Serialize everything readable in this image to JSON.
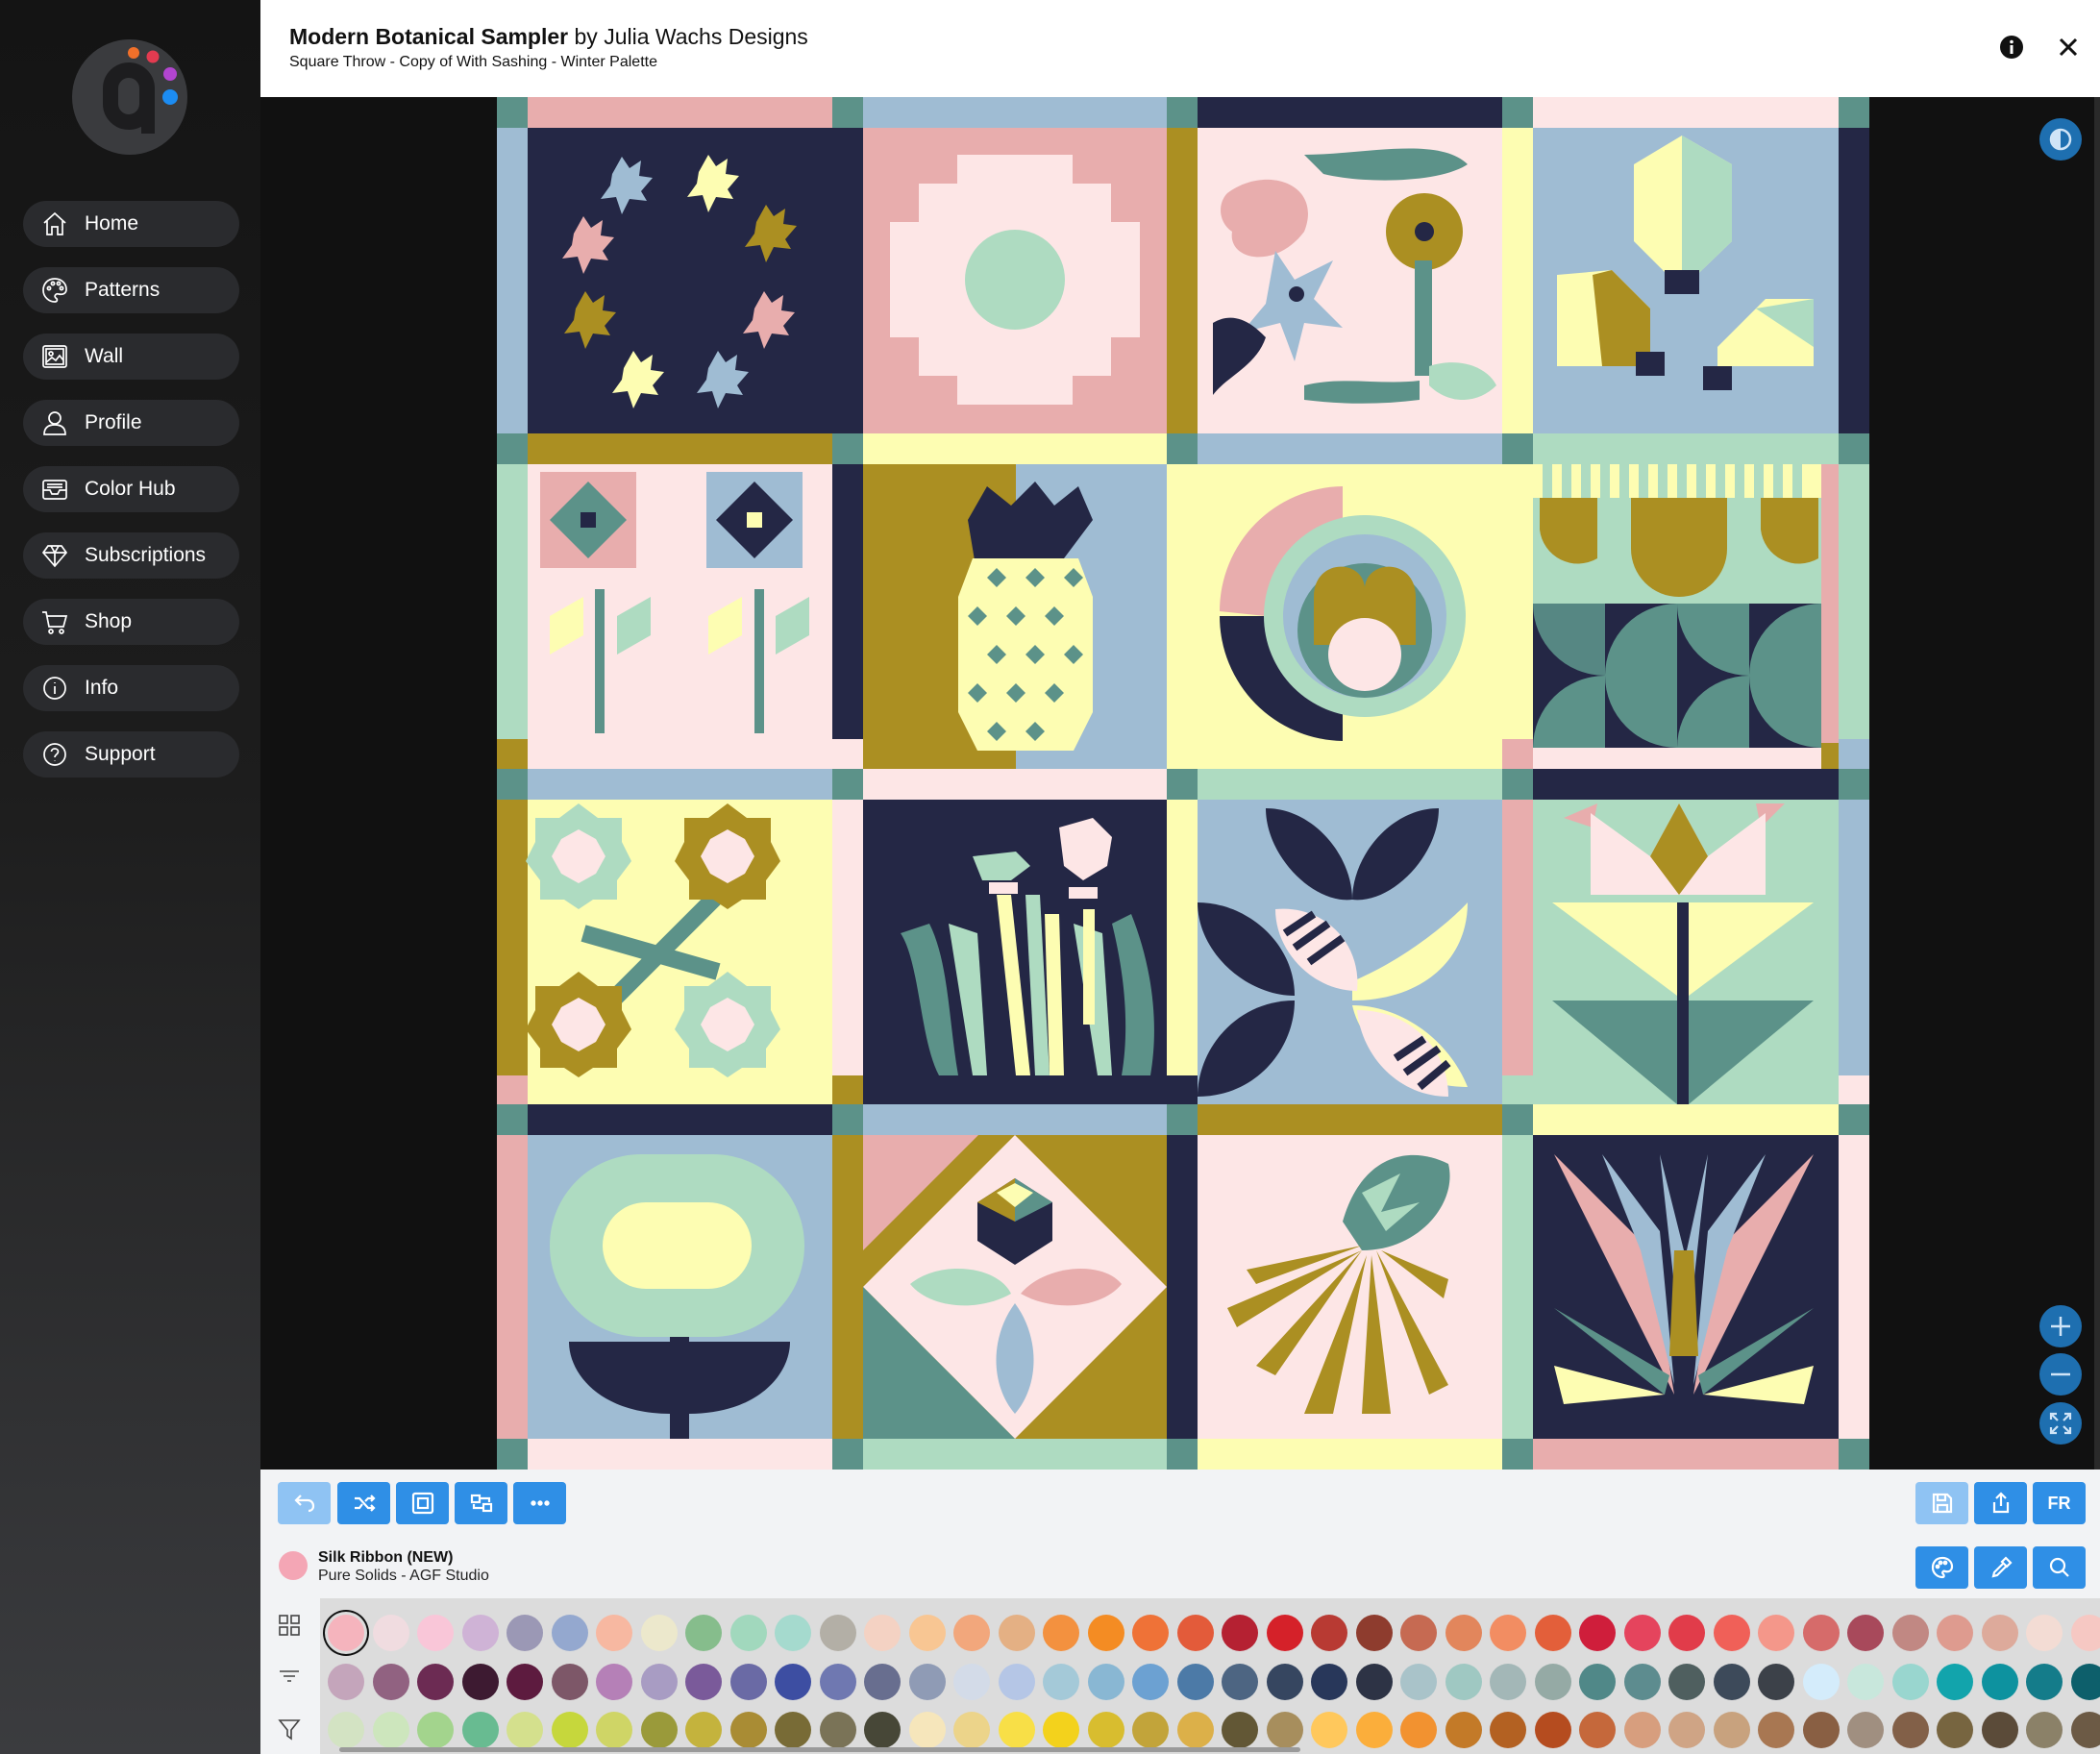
{
  "app": {
    "title_bold": "Modern Botanical Sampler",
    "title_rest": " by Julia Wachs Designs",
    "subtitle": "Square Throw - Copy of With Sashing - Winter Palette"
  },
  "sidebar": {
    "items": [
      {
        "label": "Home",
        "icon": "home-icon"
      },
      {
        "label": "Patterns",
        "icon": "palette-icon"
      },
      {
        "label": "Wall",
        "icon": "image-icon"
      },
      {
        "label": "Profile",
        "icon": "user-icon"
      },
      {
        "label": "Color Hub",
        "icon": "inbox-icon"
      },
      {
        "label": "Subscriptions",
        "icon": "diamond-icon"
      },
      {
        "label": "Shop",
        "icon": "cart-icon"
      },
      {
        "label": "Info",
        "icon": "info-icon"
      },
      {
        "label": "Support",
        "icon": "help-icon"
      }
    ]
  },
  "toolbar": {
    "left": [
      "undo-icon",
      "shuffle-icon",
      "select-block-icon",
      "swap-icon",
      "more-icon"
    ],
    "right": [
      "save-icon",
      "share-icon"
    ],
    "lang_label": "FR"
  },
  "fabric": {
    "name": "Silk Ribbon (NEW)",
    "line": "Pure Solids - AGF Studio",
    "color": "#f4a6b5"
  },
  "colors": {
    "navy": "#242745",
    "pink": "#e8adad",
    "lightpink": "#fde6e6",
    "mint": "#aedbc1",
    "teal": "#5c9289",
    "yellow": "#fdfdb2",
    "mustard": "#ab8f22",
    "blue": "#9fbcd3",
    "accent": "#2f8fe6"
  },
  "palette_rows": [
    [
      "#f5b4bd",
      "#f0dce0",
      "#f9c6d8",
      "#cfb3d6",
      "#9b98b5",
      "#94a8cf",
      "#f7b8a1",
      "#ece8cc",
      "#86bd8c",
      "#a1d8bd",
      "#a5dace",
      "#b3afa6",
      "#f4d2c3",
      "#f8c693",
      "#f2a77c",
      "#e4b084",
      "#f3913f",
      "#f48c23",
      "#ef7237",
      "#e35b3a",
      "#b52132",
      "#d52129",
      "#b83a33",
      "#8e3c2e",
      "#c66a52",
      "#e2865c",
      "#f28d62",
      "#e35f3a",
      "#cf1e3b",
      "#e5445d",
      "#e13c4a",
      "#f06058",
      "#f4978a",
      "#d66b6a",
      "#a8495b",
      "#c18883",
      "#de9b8f",
      "#ddaa9b",
      "#f3dcd4",
      "#f6c8c3"
    ],
    [
      "#c4a5bb",
      "#916281",
      "#6c2b53",
      "#3d1a31",
      "#5d1b3f",
      "#7d5768",
      "#b580b7",
      "#a89cc3",
      "#7a5a9a",
      "#6a6aa5",
      "#3d4ea2",
      "#6f78b1",
      "#686e8f",
      "#8f9bb5",
      "#d3dbe8",
      "#b5c6e6",
      "#a4c9d8",
      "#89b7d3",
      "#6ca1d2",
      "#4c7aa7",
      "#4d6582",
      "#364660",
      "#28375a",
      "#2d3345",
      "#a9c3c9",
      "#9fc8c2",
      "#a3b7b7",
      "#95aaa5",
      "#508888",
      "#5d8c8f",
      "#4f5f5f",
      "#3d4a5a",
      "#3c4149",
      "#d4ecfb",
      "#c8e7dc",
      "#99d6cf",
      "#12a4ac",
      "#0d929f",
      "#147c8a",
      "#0d5f6b"
    ],
    [
      "#d3e3c3",
      "#cde6bd",
      "#a3d48d",
      "#68bb91",
      "#d4e08d",
      "#c6d73c",
      "#cfd566",
      "#9a9a3a",
      "#c4b33d",
      "#a98c34",
      "#786b36",
      "#7a7357",
      "#474737",
      "#f6e6bb",
      "#ecd48a",
      "#f8df47",
      "#f3d21c",
      "#d8bd2f",
      "#c2a43a",
      "#dcb049",
      "#625735",
      "#a78e5d",
      "#ffc85c",
      "#fbae3b",
      "#f29230",
      "#c37a28",
      "#b36122",
      "#b54c1f",
      "#c5683b",
      "#d79e7e",
      "#cfa485",
      "#c8a27e",
      "#a87752",
      "#895f43",
      "#a08f80",
      "#826048",
      "#776540",
      "#5b4b39",
      "#8b8168",
      "#6c5a45"
    ]
  ]
}
